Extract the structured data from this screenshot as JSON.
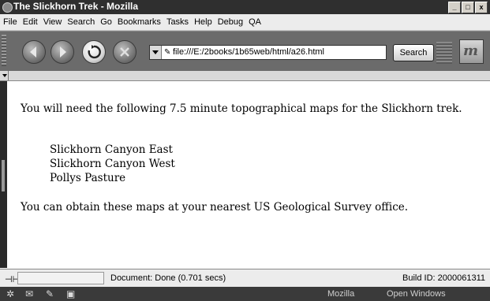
{
  "window": {
    "title": "The Slickhorn Trek - Mozilla",
    "controls": [
      "_",
      "□",
      "x"
    ]
  },
  "menu": [
    "File",
    "Edit",
    "View",
    "Search",
    "Go",
    "Bookmarks",
    "Tasks",
    "Help",
    "Debug",
    "QA"
  ],
  "toolbar": {
    "url": "file:///E:/2books/1b65web/html/a26.html",
    "search_label": "Search",
    "throbber_glyph": "m"
  },
  "content": {
    "intro": "You will need the following 7.5 minute topographical maps for the Slickhorn trek.",
    "maps": [
      "Slickhorn Canyon East",
      "Slickhorn Canyon West",
      "Pollys Pasture"
    ],
    "outro": "You can obtain these maps at your nearest US Geological Survey office."
  },
  "status": {
    "text": "Document: Done (0.701 secs)",
    "build": "Build ID: 2000061311"
  },
  "components": {
    "mozilla": "Mozilla",
    "open_windows": "Open Windows"
  }
}
